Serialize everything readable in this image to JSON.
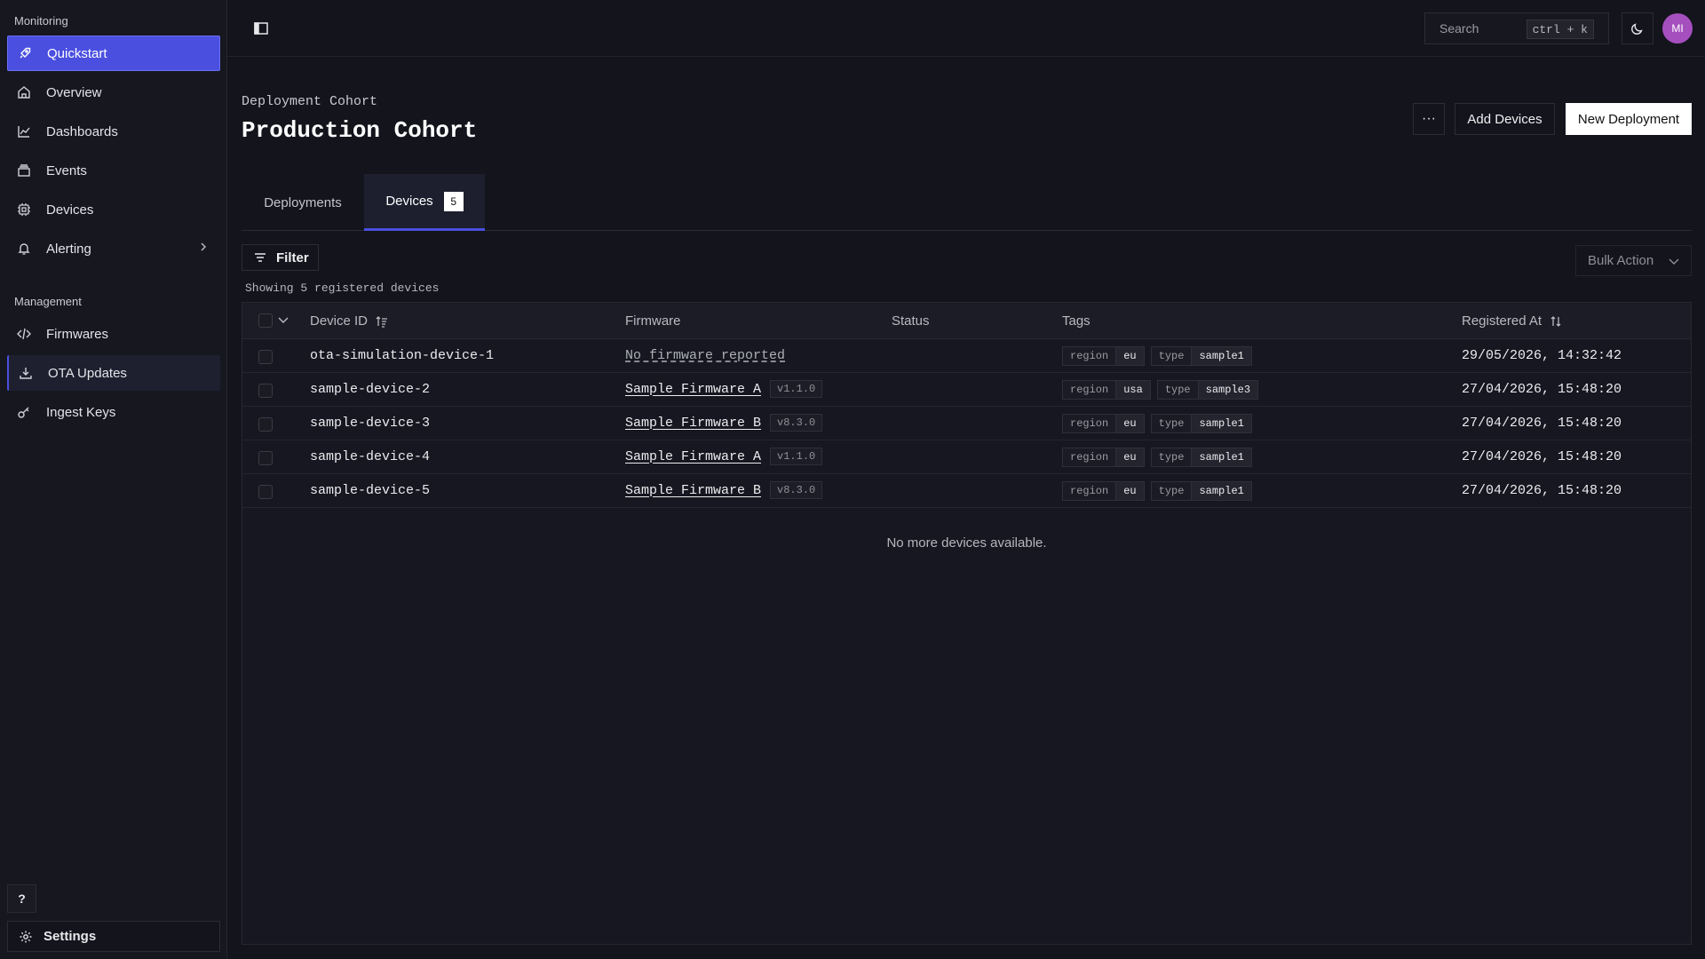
{
  "sidebar": {
    "monitoring_label": "Monitoring",
    "management_label": "Management",
    "items": [
      {
        "label": "Quickstart",
        "icon": "rocket-icon"
      },
      {
        "label": "Overview",
        "icon": "home-icon"
      },
      {
        "label": "Dashboards",
        "icon": "chart-line-icon"
      },
      {
        "label": "Events",
        "icon": "stack-icon"
      },
      {
        "label": "Devices",
        "icon": "chip-icon"
      },
      {
        "label": "Alerting",
        "icon": "bell-icon"
      },
      {
        "label": "Firmwares",
        "icon": "code-icon"
      },
      {
        "label": "OTA Updates",
        "icon": "download-icon"
      },
      {
        "label": "Ingest Keys",
        "icon": "key-icon"
      }
    ],
    "help_label": "?",
    "settings_label": "Settings"
  },
  "topbar": {
    "search_placeholder": "Search",
    "search_shortcut": "ctrl + k",
    "avatar_initials": "MI"
  },
  "header": {
    "breadcrumb": "Deployment Cohort",
    "title": "Production Cohort",
    "more_label": "···",
    "add_devices_label": "Add Devices",
    "new_deployment_label": "New Deployment"
  },
  "tabs": [
    {
      "label": "Deployments"
    },
    {
      "label": "Devices",
      "count": "5"
    }
  ],
  "toolbar": {
    "filter_label": "Filter",
    "bulk_action_label": "Bulk Action",
    "showing_label": "Showing 5 registered devices"
  },
  "table": {
    "columns": [
      "Device ID",
      "Firmware",
      "Status",
      "Tags",
      "Registered At"
    ],
    "rows": [
      {
        "device_id": "ota-simulation-device-1",
        "firmware": "No firmware reported",
        "version": "",
        "status": "",
        "tags": [
          {
            "k": "region",
            "v": "eu"
          },
          {
            "k": "type",
            "v": "sample1"
          }
        ],
        "registered": "29/05/2026, 14:32:42"
      },
      {
        "device_id": "sample-device-2",
        "firmware": "Sample Firmware A",
        "version": "v1.1.0",
        "status": "",
        "tags": [
          {
            "k": "region",
            "v": "usa"
          },
          {
            "k": "type",
            "v": "sample3"
          }
        ],
        "registered": "27/04/2026, 15:48:20"
      },
      {
        "device_id": "sample-device-3",
        "firmware": "Sample Firmware B",
        "version": "v8.3.0",
        "status": "",
        "tags": [
          {
            "k": "region",
            "v": "eu"
          },
          {
            "k": "type",
            "v": "sample1"
          }
        ],
        "registered": "27/04/2026, 15:48:20"
      },
      {
        "device_id": "sample-device-4",
        "firmware": "Sample Firmware A",
        "version": "v1.1.0",
        "status": "",
        "tags": [
          {
            "k": "region",
            "v": "eu"
          },
          {
            "k": "type",
            "v": "sample1"
          }
        ],
        "registered": "27/04/2026, 15:48:20"
      },
      {
        "device_id": "sample-device-5",
        "firmware": "Sample Firmware B",
        "version": "v8.3.0",
        "status": "",
        "tags": [
          {
            "k": "region",
            "v": "eu"
          },
          {
            "k": "type",
            "v": "sample1"
          }
        ],
        "registered": "27/04/2026, 15:48:20"
      }
    ],
    "empty_message": "No more devices available."
  },
  "colors": {
    "accent": "#4a4fe0",
    "background": "#13141c",
    "avatar": "#a54fbf"
  }
}
